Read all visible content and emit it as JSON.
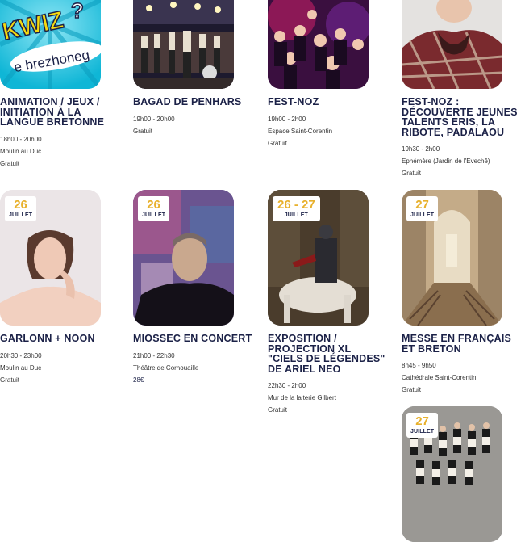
{
  "colors": {
    "title": "#1b2147",
    "date": "#e8b12d"
  },
  "events": [
    {
      "title": "ANIMATION / JEUX / INITIATION À LA LANGUE BRETONNE",
      "time": "18h00 - 20h00",
      "place": "Moulin au Duc",
      "price": "Gratuit",
      "image_text": "KWIZ? e brezhoneg"
    },
    {
      "title": "BAGAD DE PENHARS",
      "time": "19h00 - 20h00",
      "place": "",
      "price": "Gratuit"
    },
    {
      "title": "FEST-NOZ",
      "time": "19h00 - 2h00",
      "place": "Espace Saint-Corentin",
      "price": "Gratuit"
    },
    {
      "title": "FEST-NOZ : DÉCOUVERTE JEUNES TALENTS ERIS, LA RIBOTE, PADALAOU",
      "time": "19h30 - 2h00",
      "place": "Ephémère (Jardin de l'Evechê)",
      "price": "Gratuit"
    },
    {
      "date": "26",
      "month": "JUILLET",
      "title": "GARLONN + NOON",
      "time": "20h30 - 23h00",
      "place": "Moulin au Duc",
      "price": "Gratuit"
    },
    {
      "date": "26",
      "month": "JUILLET",
      "title": "MIOSSEC EN CONCERT",
      "time": "21h00 - 22h30",
      "place": "Théâtre de Cornouaille",
      "price": "28€"
    },
    {
      "date": "26 - 27",
      "month": "JUILLET",
      "title": "EXPOSITION / PROJECTION XL \"CIELS DE LÉGENDES\" DE ARIEL NEO",
      "time": "22h30 - 2h00",
      "place": "Mur de la laiterie Gilbert",
      "price": "Gratuit"
    },
    {
      "date": "27",
      "month": "JUILLET",
      "title": "MESSE EN FRANÇAIS ET BRETON",
      "time": "8h45 - 9h50",
      "place": "Cathédrale Saint-Corentin",
      "price": "Gratuit"
    },
    {
      "date": "27",
      "month": "JUILLET"
    }
  ]
}
